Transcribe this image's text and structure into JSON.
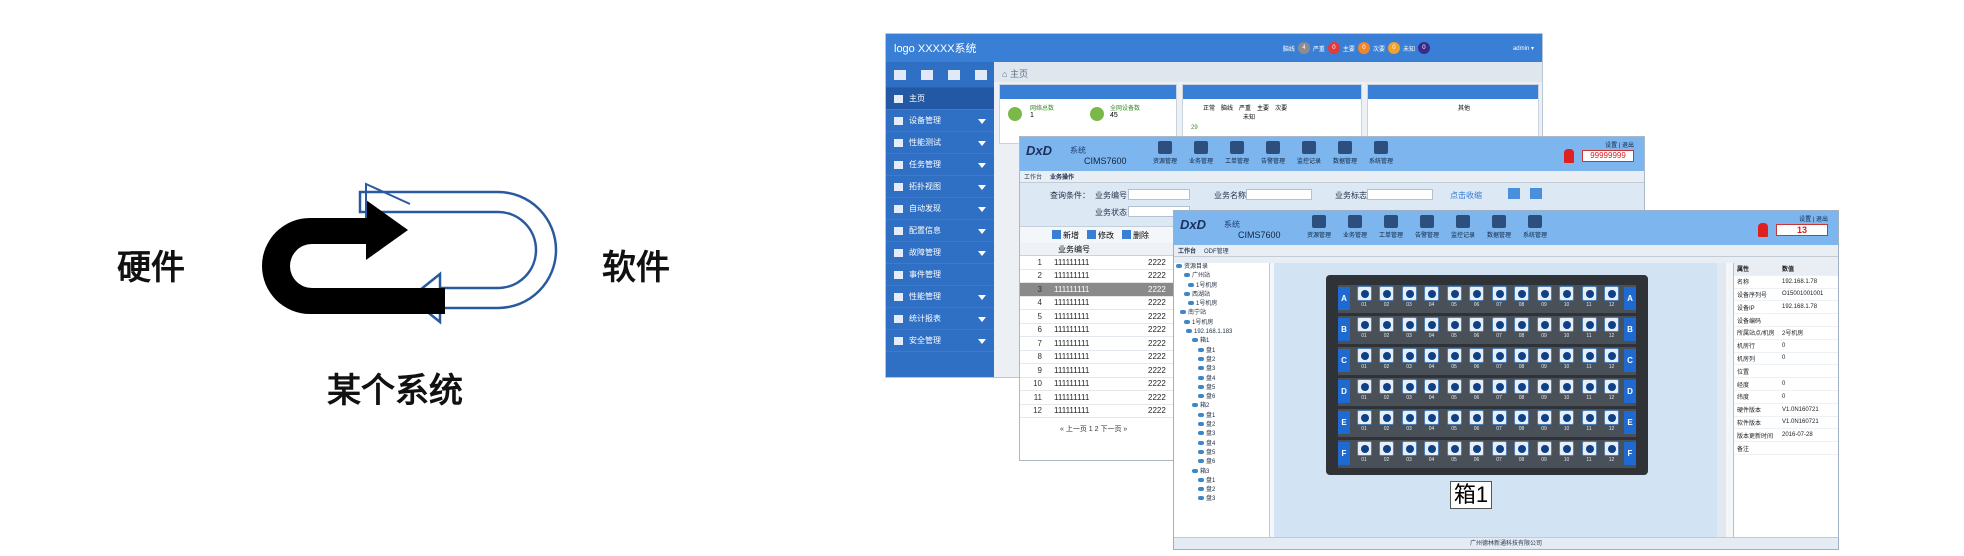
{
  "diagram": {
    "left_label": "硬件",
    "right_label": "软件",
    "bottom_label": "某个系统"
  },
  "window1": {
    "header": {
      "logo": "logo   XXXXX系统",
      "status_labels": [
        "脑线",
        "严重",
        "主要",
        "次要",
        "未知"
      ],
      "status_counts": [
        "4",
        "0",
        "0",
        "0",
        "0"
      ],
      "status_colors": [
        "#8c8c8c",
        "#e23b3b",
        "#f0862b",
        "#f0a22b",
        "#3a2b8c"
      ],
      "user": "admin ▾"
    },
    "breadcrumb": "主页",
    "sidebar_top_icons": [
      "设备",
      "拓扑",
      "统计",
      "告警"
    ],
    "sidebar": [
      "主页",
      "设备管理",
      "性能测试",
      "任务管理",
      "拓扑视图",
      "自动发现",
      "配置信息",
      "故障管理",
      "事件管理",
      "性能管理",
      "统计报表",
      "安全管理"
    ],
    "panel_labels": [
      "网络总数",
      "全网设备数",
      "正常",
      "脑线",
      "严重",
      "主要",
      "次要",
      "未知",
      "其他"
    ],
    "panel_values": [
      "1",
      "45",
      "29"
    ]
  },
  "window2": {
    "title": "系统",
    "product": "CIMS7600",
    "toolbar": [
      "资源管理",
      "业务管理",
      "工单管理",
      "告警管理",
      "监控记录",
      "数据管理",
      "系统管理"
    ],
    "alarm_count": "99999999",
    "top_right": "设置 | 退出",
    "tabs": [
      "工作台",
      "业务操作"
    ],
    "query": {
      "condition_label": "查询条件：",
      "service_no": "业务编号",
      "service_name": "业务名称",
      "service_flag": "业务标志",
      "service_status": "业务状态",
      "search_link": "点击收缩"
    },
    "actions": [
      "新增",
      "修改",
      "删除"
    ],
    "col_header": "业务编号",
    "row_numbers": [
      "1",
      "2",
      "3",
      "4",
      "5",
      "6",
      "7",
      "8",
      "9",
      "10",
      "11",
      "12"
    ],
    "row_value": "111111111",
    "row_value2": "2222",
    "pager": "« 上一页  1  2  下一页 »"
  },
  "window3": {
    "title": "系统",
    "product": "CIMS7600",
    "toolbar": [
      "资源管理",
      "业务管理",
      "工单管理",
      "告警管理",
      "监控记录",
      "数据管理",
      "系统管理"
    ],
    "alarm_count": "13",
    "top_right": "设置 | 退出",
    "tabs": [
      "工作台",
      "ODF管理"
    ],
    "tree": [
      "资源目录",
      "广州站",
      "1号机房",
      "西湖站",
      "1号机房",
      "南宁站",
      "1号机房",
      "192.168.1.183",
      "箱1",
      "盘1",
      "盘2",
      "盘3",
      "盘4",
      "盘5",
      "盘6",
      "箱2",
      "盘1",
      "盘2",
      "盘3",
      "盘4",
      "盘5",
      "盘6",
      "箱3",
      "盘1",
      "盘2",
      "盘3"
    ],
    "rack_rows": [
      "A",
      "B",
      "C",
      "D",
      "E",
      "F"
    ],
    "port_numbers": [
      "01",
      "02",
      "03",
      "04",
      "05",
      "06",
      "07",
      "08",
      "09",
      "10",
      "11",
      "12"
    ],
    "box_label": "箱1",
    "props_header": [
      "属性",
      "数值"
    ],
    "props": [
      [
        "名称",
        "192.168.1.78"
      ],
      [
        "设备序列号",
        "O15001001001"
      ],
      [
        "设备IP",
        "192.168.1.78"
      ],
      [
        "设备编码",
        ""
      ],
      [
        "所属站点/机房",
        "2号机房"
      ],
      [
        "机房行",
        "0"
      ],
      [
        "机房列",
        "0"
      ],
      [
        "位置",
        ""
      ],
      [
        "经度",
        "0"
      ],
      [
        "纬度",
        "0"
      ],
      [
        "硬件版本",
        "V1.0N160721"
      ],
      [
        "软件版本",
        "V1.0N160721"
      ],
      [
        "版本更新时间",
        "2016-07-28"
      ],
      [
        "备注",
        ""
      ]
    ],
    "footer": "广州德林新通科技有限公司"
  }
}
